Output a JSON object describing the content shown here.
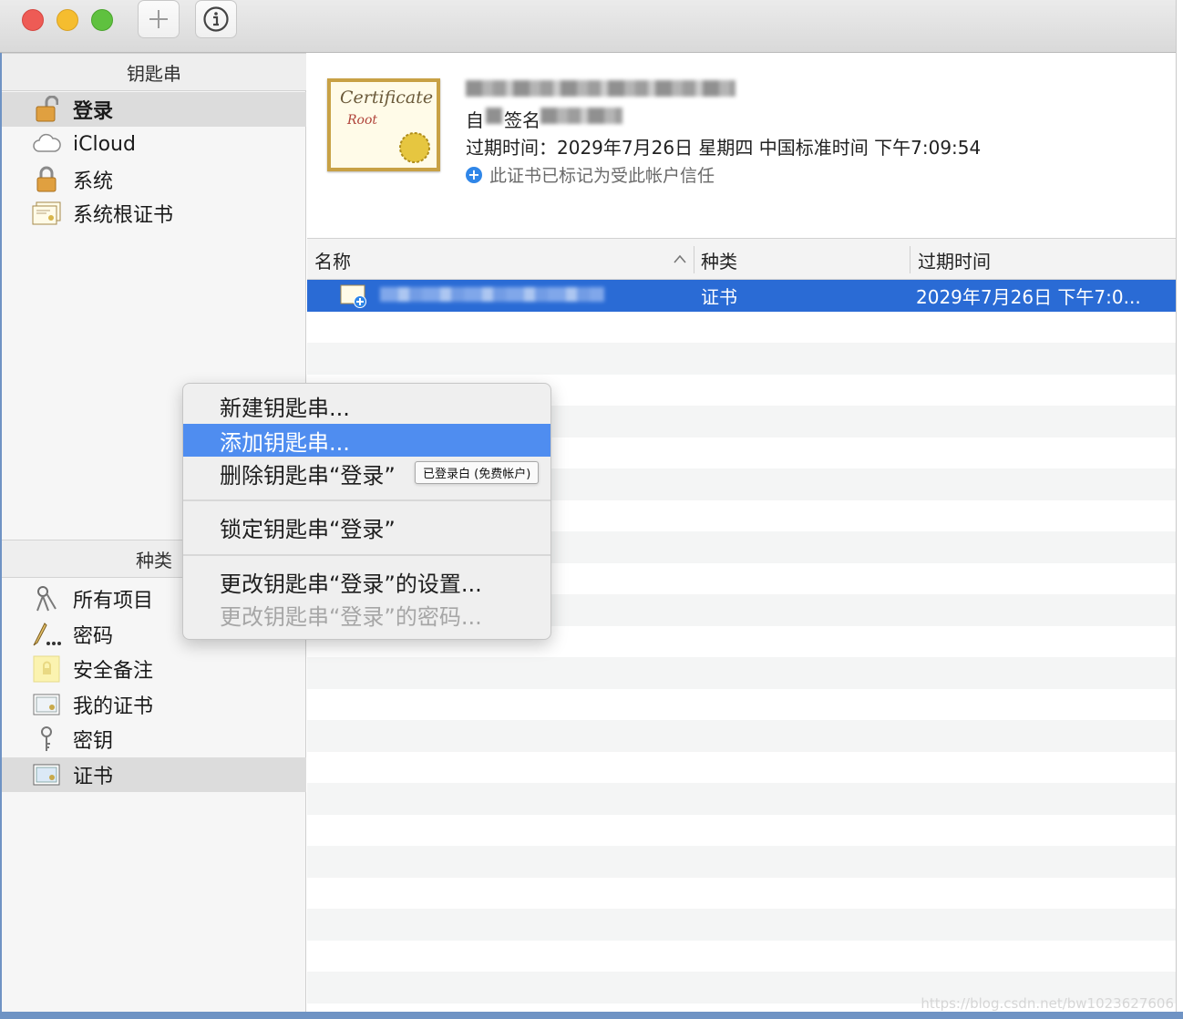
{
  "toolbar": {
    "add_icon": "plus-icon",
    "info_icon": "info-icon"
  },
  "sidebar": {
    "keychains_header": "钥匙串",
    "keychains": [
      {
        "label": "登录",
        "icon": "unlocked-padlock-icon",
        "selected": true
      },
      {
        "label": "iCloud",
        "icon": "cloud-icon"
      },
      {
        "label": "系统",
        "icon": "padlock-icon"
      },
      {
        "label": "系统根证书",
        "icon": "certificate-stack-icon"
      }
    ],
    "categories_header": "种类",
    "categories": [
      {
        "label": "所有项目",
        "icon": "keys-icon"
      },
      {
        "label": "密码",
        "icon": "pencil-dots-icon"
      },
      {
        "label": "安全备注",
        "icon": "secure-note-icon"
      },
      {
        "label": "我的证书",
        "icon": "my-certificate-icon"
      },
      {
        "label": "密钥",
        "icon": "key-icon"
      },
      {
        "label": "证书",
        "icon": "certificate-icon",
        "selected": true
      }
    ]
  },
  "detail": {
    "cert_title_line1": "Certificate",
    "cert_title_line2": "Root",
    "self_signed_prefix": "自",
    "self_signed_label": "签名",
    "expiry": "过期时间：2029年7月26日 星期四 中国标准时间 下午7:09:54",
    "trust_note": "此证书已标记为受此帐户信任"
  },
  "table": {
    "col_name": "名称",
    "col_kind": "种类",
    "col_expiry": "过期时间",
    "selected_row": {
      "kind": "证书",
      "expiry": "2029年7月26日 下午7:0..."
    }
  },
  "context_menu": {
    "items": [
      {
        "label": "新建钥匙串..."
      },
      {
        "label": "添加钥匙串...",
        "highlighted": true
      },
      {
        "label": "删除钥匙串“登录”"
      },
      {
        "label": "锁定钥匙串“登录”"
      },
      {
        "label": "更改钥匙串“登录”的设置..."
      },
      {
        "label": "更改钥匙串“登录”的密码...",
        "disabled": true
      }
    ],
    "tooltip": "已登录白 (免费帐户)"
  },
  "watermark": "https://blog.csdn.net/bw1023627606",
  "colors": {
    "selection_blue": "#2a6bd5",
    "menu_highlight": "#4f8df0",
    "trust_blue": "#2f86e8"
  }
}
